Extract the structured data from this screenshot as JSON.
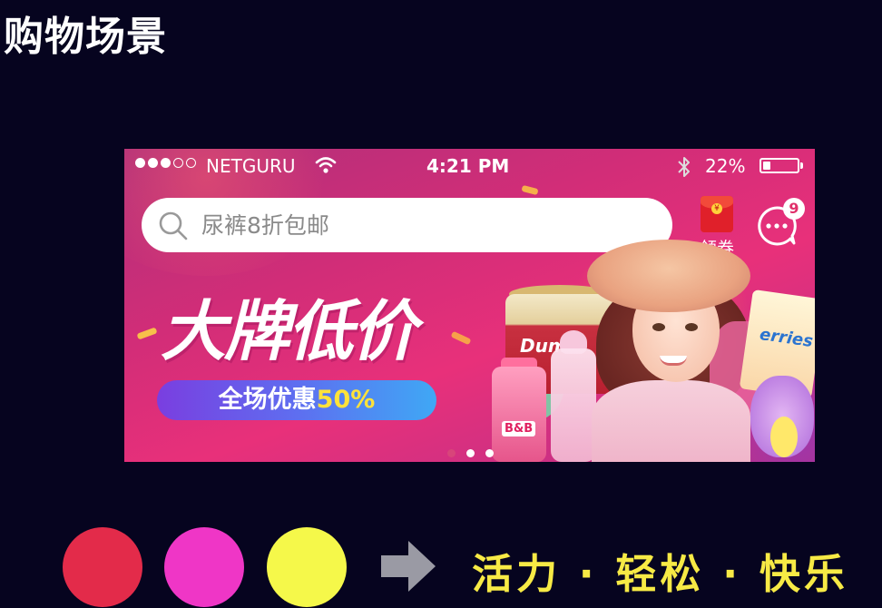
{
  "slide": {
    "title": "购物场景"
  },
  "status_bar": {
    "carrier": "NETGURU",
    "time": "4:21 PM",
    "battery": "22%",
    "battery_level": 0.22,
    "signal_dots": [
      true,
      true,
      true,
      false,
      false
    ]
  },
  "search": {
    "placeholder": "尿裤8折包邮"
  },
  "header": {
    "coupon_label": "领券",
    "coupon_icon": "red-envelope-icon",
    "message_icon": "chat-bubble-icon",
    "message_badge": "9"
  },
  "banner": {
    "headline": "大牌低价",
    "promo_text": "全场优惠",
    "promo_percent": "50%",
    "product_can_label": "Dume",
    "product_bottle_label": "B&B",
    "product_diaper_label": "erries",
    "carousel": {
      "count": 3,
      "active_index": 0
    }
  },
  "palette": {
    "colors": [
      "#e32b4a",
      "#ef36c6",
      "#f5f84a"
    ],
    "arrow_icon": "right-arrow-icon"
  },
  "slogan": {
    "text": "活力 · 轻松 · 快乐"
  }
}
